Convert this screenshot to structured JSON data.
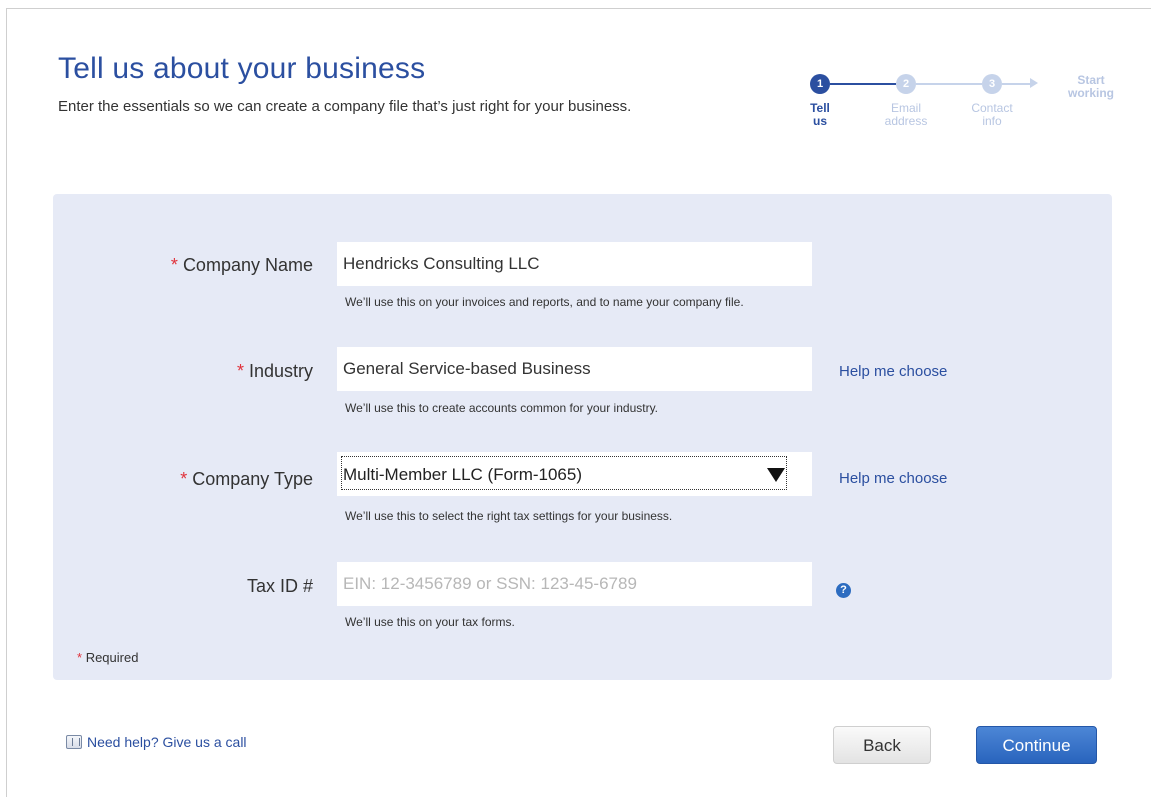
{
  "header": {
    "title": "Tell us about your business",
    "subtitle": "Enter the essentials so we can create a company file that’s just right for your business."
  },
  "stepper": {
    "steps": [
      {
        "number": "1",
        "label_line1": "Tell",
        "label_line2": "us",
        "state": "active"
      },
      {
        "number": "2",
        "label_line1": "Email",
        "label_line2": "address",
        "state": "inactive"
      },
      {
        "number": "3",
        "label_line1": "Contact",
        "label_line2": "info",
        "state": "inactive"
      }
    ],
    "end_line1": "Start",
    "end_line2": "working"
  },
  "form": {
    "required_marker": "*",
    "company_name": {
      "label": "Company Name",
      "value": "Hendricks Consulting LLC",
      "hint": "We’ll use this on your invoices and reports, and to name your company file."
    },
    "industry": {
      "label": "Industry",
      "value": "General Service-based Business",
      "hint": "We’ll use this to create accounts common for your industry.",
      "help_link": "Help me choose"
    },
    "company_type": {
      "label": "Company Type",
      "value": "Multi-Member LLC (Form-1065)",
      "hint": "We’ll use this to select the right tax settings for your business.",
      "help_link": "Help me choose"
    },
    "tax_id": {
      "label": "Tax ID #",
      "placeholder": "EIN: 12-3456789 or SSN: 123-45-6789",
      "hint": "We’ll use this on your tax forms.",
      "info_icon": "?"
    },
    "required_note": "Required"
  },
  "footer": {
    "help_link": "Need help? Give us a call",
    "back_label": "Back",
    "continue_label": "Continue"
  },
  "colors": {
    "accent": "#2b4fa0",
    "panel_bg": "#e6eaf6",
    "required": "#e0323b",
    "continue_bg": "#2964bd"
  }
}
